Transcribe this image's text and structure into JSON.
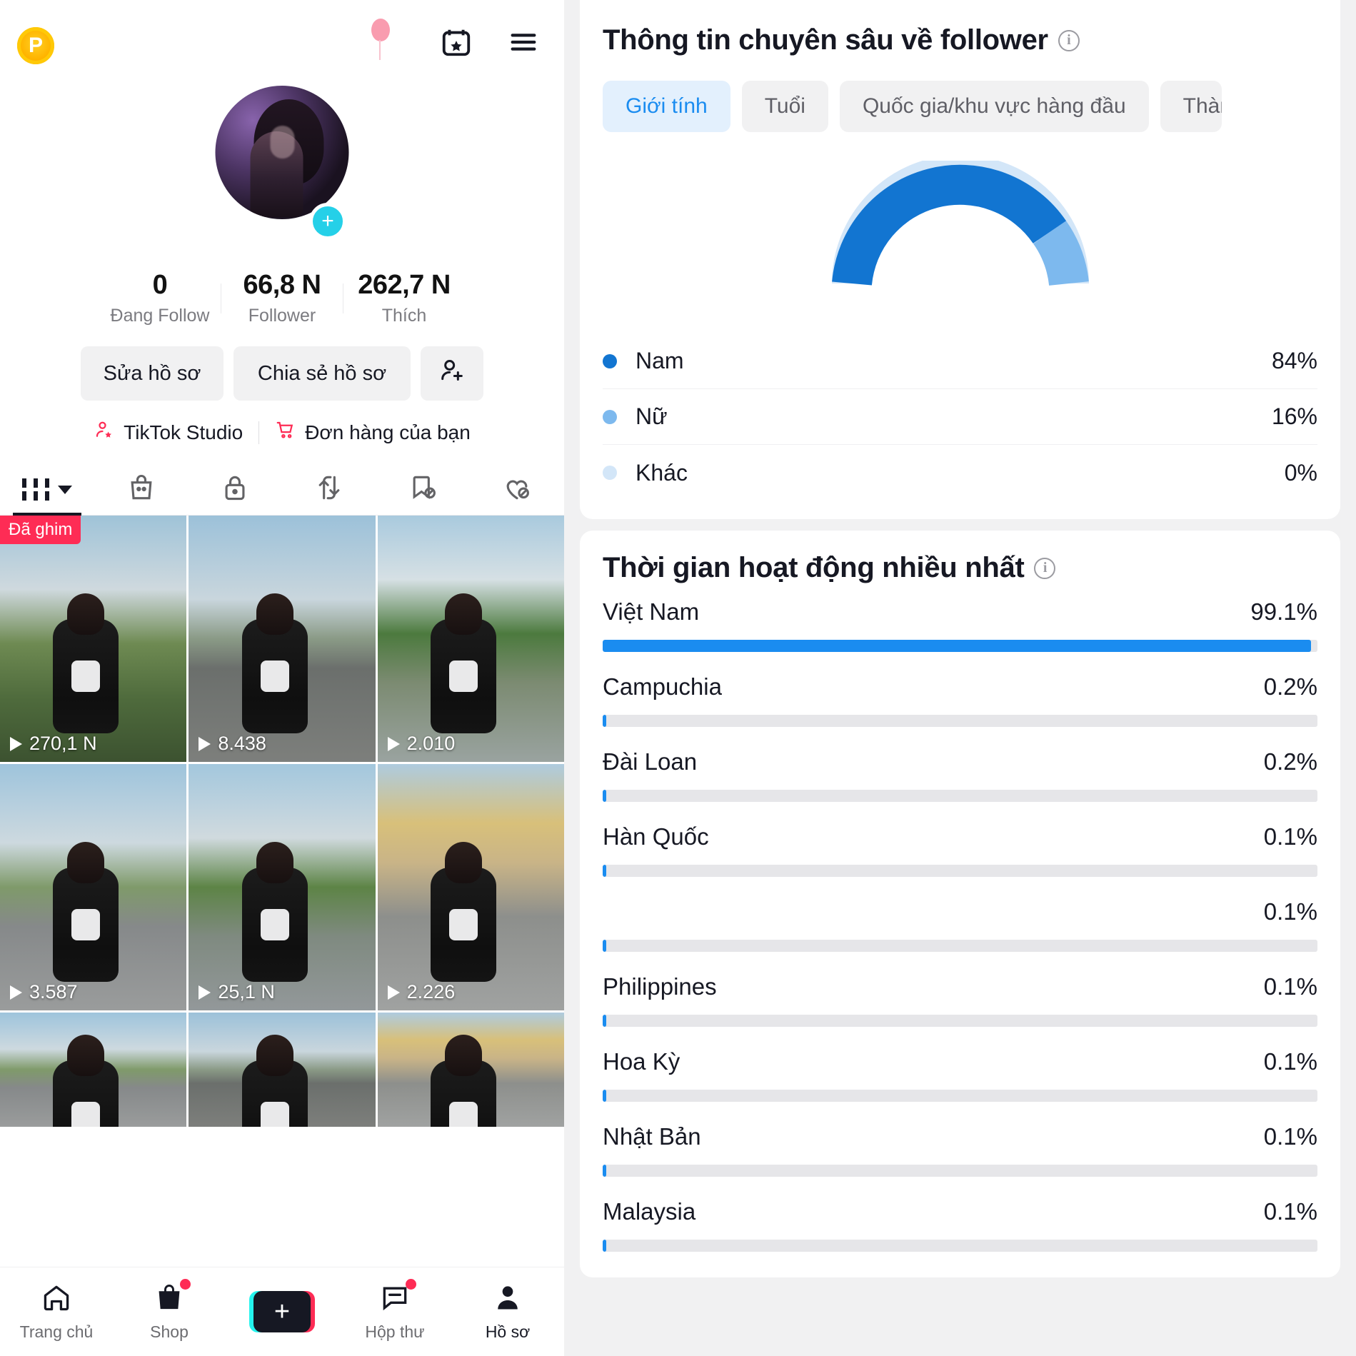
{
  "left": {
    "topbar": {
      "coin_label": "P",
      "ghost_username": "",
      "calendar_icon": "calendar-star-icon",
      "menu_icon": "hamburger-menu-icon"
    },
    "profile": {
      "avatar_icon": "profile-avatar",
      "add_icon": "+"
    },
    "stats": [
      {
        "num": "0",
        "label": "Đang Follow"
      },
      {
        "num": "66,8 N",
        "label": "Follower"
      },
      {
        "num": "262,7 N",
        "label": "Thích"
      }
    ],
    "actions": {
      "edit_profile": "Sửa hồ sơ",
      "share_profile": "Chia sẻ hồ sơ",
      "add_friend_icon": "add-person-icon"
    },
    "links": [
      {
        "label": "TikTok Studio",
        "icon": "studio-person-star-icon"
      },
      {
        "label": "Đơn hàng của bạn",
        "icon": "shopping-cart-icon"
      }
    ],
    "tabs": [
      {
        "name": "grid",
        "icon": "grid-dropdown-icon",
        "active": true
      },
      {
        "name": "shop",
        "icon": "shopping-bag-icon",
        "active": false
      },
      {
        "name": "private",
        "icon": "lock-icon",
        "active": false
      },
      {
        "name": "repost",
        "icon": "repost-arrows-icon",
        "active": false
      },
      {
        "name": "hidden-saved",
        "icon": "bookmark-slash-icon",
        "active": false
      },
      {
        "name": "hidden-liked",
        "icon": "heart-slash-icon",
        "active": false
      }
    ],
    "videos": [
      {
        "views": "270,1 N",
        "badge": "Đã ghim",
        "scene": "sc1"
      },
      {
        "views": "8.438",
        "badge": "",
        "scene": "sc2"
      },
      {
        "views": "2.010",
        "badge": "",
        "scene": "sc3"
      },
      {
        "views": "3.587",
        "badge": "",
        "scene": "sc4"
      },
      {
        "views": "25,1 N",
        "badge": "",
        "scene": "sc5"
      },
      {
        "views": "2.226",
        "badge": "",
        "scene": "sc6"
      }
    ],
    "videos_partial": [
      {
        "scene": "sc4"
      },
      {
        "scene": "sc2"
      },
      {
        "scene": "sc6"
      }
    ],
    "bottom_nav": [
      {
        "label": "Trang chủ",
        "icon": "home-icon",
        "badge": false,
        "active": false
      },
      {
        "label": "Shop",
        "icon": "shop-bag-icon",
        "badge": true,
        "active": false
      },
      {
        "label": "",
        "icon": "create-plus-icon",
        "badge": false,
        "active": false
      },
      {
        "label": "Hộp thư",
        "icon": "inbox-message-icon",
        "badge": true,
        "active": false
      },
      {
        "label": "Hồ sơ",
        "icon": "profile-person-icon",
        "badge": false,
        "active": true
      }
    ]
  },
  "right": {
    "follower_card": {
      "title": "Thông tin chuyên sâu về follower",
      "info_icon": "info-icon",
      "chips": [
        {
          "label": "Giới tính",
          "selected": true
        },
        {
          "label": "Tuổi",
          "selected": false
        },
        {
          "label": "Quốc gia/khu vực hàng đầu",
          "selected": false
        },
        {
          "label": "Thàn",
          "selected": false
        }
      ]
    },
    "activity_card": {
      "title": "Thời gian hoạt động nhiều nhất",
      "info_icon": "info-icon"
    },
    "colors": {
      "primary_blue": "#1a8cf0",
      "light_blue": "#7db9ee",
      "pale_blue": "#d3e6f8",
      "track_gray": "#e6e6e9",
      "chip_selected_bg": "#e3f0fd"
    }
  },
  "chart_data": [
    {
      "type": "pie",
      "title": "Giới tính",
      "subtitle": "Thông tin chuyên sâu về follower",
      "legend_position": "below",
      "categories": [
        "Nam",
        "Nữ",
        "Khác"
      ],
      "values": [
        84,
        16,
        0
      ],
      "labels": [
        "84%",
        "16%",
        "0%"
      ],
      "colors": [
        "#1a8cf0",
        "#7db9ee",
        "#d3e6f8"
      ],
      "note": "half-donut gauge, 180 degree sweep"
    },
    {
      "type": "bar",
      "title": "Thời gian hoạt động nhiều nhất",
      "orientation": "horizontal",
      "xlabel": "",
      "ylabel": "",
      "xlim": [
        0,
        100
      ],
      "grid": false,
      "categories": [
        "Việt Nam",
        "Campuchia",
        "Đài Loan",
        "Hàn Quốc",
        "",
        "Philippines",
        "Hoa Kỳ",
        "Nhật Bản",
        "Malaysia"
      ],
      "values": [
        99.1,
        0.2,
        0.2,
        0.1,
        0.1,
        0.1,
        0.1,
        0.1,
        0.1
      ],
      "labels": [
        "99.1%",
        "0.2%",
        "0.2%",
        "0.1%",
        "0.1%",
        "0.1%",
        "0.1%",
        "0.1%",
        "0.1%"
      ],
      "bar_color": "#1a8cf0",
      "track_color": "#e6e6e9"
    }
  ]
}
